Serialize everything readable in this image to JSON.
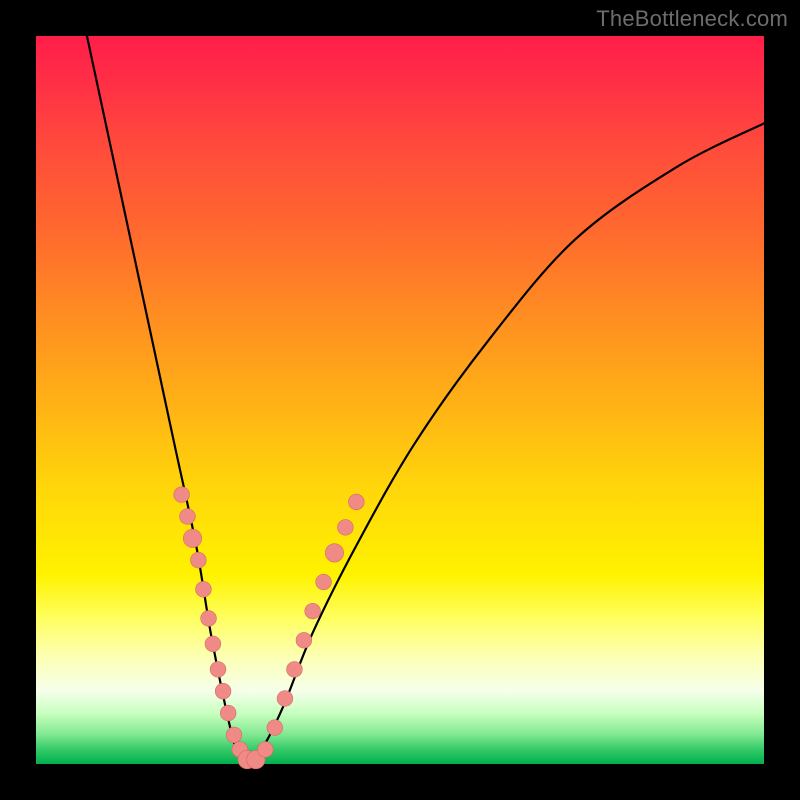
{
  "watermark": "TheBottleneck.com",
  "colors": {
    "curve": "#000000",
    "dot_fill": "#f08a86",
    "dot_stroke": "#d46a63"
  },
  "chart_data": {
    "type": "line",
    "title": "",
    "xlabel": "",
    "ylabel": "",
    "xlim": [
      0,
      100
    ],
    "ylim": [
      0,
      100
    ],
    "grid": false,
    "legend": false,
    "series": [
      {
        "name": "bottleneck-curve",
        "x": [
          7,
          10,
          13,
          16,
          19,
          22,
          24,
          26,
          27.5,
          29,
          31,
          34,
          38,
          44,
          52,
          62,
          74,
          88,
          100
        ],
        "values": [
          100,
          86,
          72,
          58,
          44,
          30,
          18,
          8,
          2,
          0,
          2,
          8,
          18,
          30,
          44,
          58,
          72,
          82,
          88
        ]
      }
    ],
    "markers": [
      {
        "x": 20.0,
        "y": 37.0,
        "r": 1.2
      },
      {
        "x": 20.8,
        "y": 34.0,
        "r": 1.2
      },
      {
        "x": 21.5,
        "y": 31.0,
        "r": 1.4
      },
      {
        "x": 22.3,
        "y": 28.0,
        "r": 1.2
      },
      {
        "x": 23.0,
        "y": 24.0,
        "r": 1.2
      },
      {
        "x": 23.7,
        "y": 20.0,
        "r": 1.2
      },
      {
        "x": 24.3,
        "y": 16.5,
        "r": 1.2
      },
      {
        "x": 25.0,
        "y": 13.0,
        "r": 1.2
      },
      {
        "x": 25.7,
        "y": 10.0,
        "r": 1.2
      },
      {
        "x": 26.4,
        "y": 7.0,
        "r": 1.2
      },
      {
        "x": 27.2,
        "y": 4.0,
        "r": 1.2
      },
      {
        "x": 28.0,
        "y": 2.0,
        "r": 1.2
      },
      {
        "x": 29.0,
        "y": 0.6,
        "r": 1.4
      },
      {
        "x": 30.2,
        "y": 0.6,
        "r": 1.4
      },
      {
        "x": 31.5,
        "y": 2.0,
        "r": 1.2
      },
      {
        "x": 32.8,
        "y": 5.0,
        "r": 1.2
      },
      {
        "x": 34.2,
        "y": 9.0,
        "r": 1.2
      },
      {
        "x": 35.5,
        "y": 13.0,
        "r": 1.2
      },
      {
        "x": 36.8,
        "y": 17.0,
        "r": 1.2
      },
      {
        "x": 38.0,
        "y": 21.0,
        "r": 1.2
      },
      {
        "x": 39.5,
        "y": 25.0,
        "r": 1.2
      },
      {
        "x": 41.0,
        "y": 29.0,
        "r": 1.4
      },
      {
        "x": 42.5,
        "y": 32.5,
        "r": 1.2
      },
      {
        "x": 44.0,
        "y": 36.0,
        "r": 1.2
      }
    ]
  }
}
